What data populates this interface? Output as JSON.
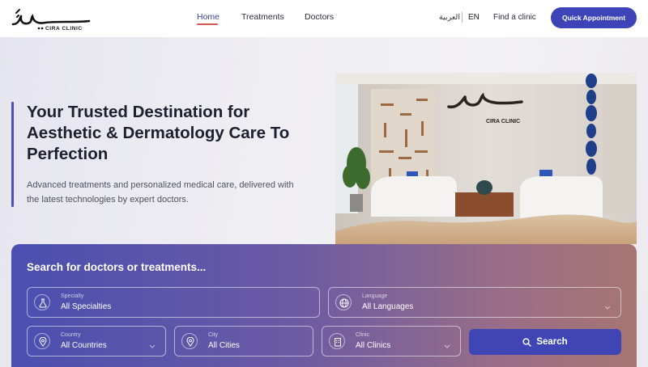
{
  "header": {
    "logo_arabic": "سيرا",
    "logo_text": "CIRA CLINIC",
    "nav": [
      {
        "label": "Home"
      },
      {
        "label": "Treatments"
      },
      {
        "label": "Doctors"
      }
    ],
    "lang_arabic": "العربية",
    "lang_english": "EN",
    "find_clinic": "Find a clinic",
    "cta": "Quick Appointment"
  },
  "hero": {
    "title": "Your Trusted Destination for Aesthetic & Dermatology Care To Perfection",
    "subtitle": "Advanced treatments and personalized medical care, delivered with the latest technologies by expert doctors.",
    "image_sign_arabic": "سيرا",
    "image_sign_text": "CIRA CLINIC"
  },
  "search": {
    "title": "Search for doctors or treatments...",
    "fields": {
      "specialty": {
        "label": "Specialty",
        "value": "All Specialties",
        "icon": "flask-icon"
      },
      "language": {
        "label": "Language",
        "value": "All Languages",
        "icon": "globe-icon"
      },
      "country": {
        "label": "Country",
        "value": "All Countries",
        "icon": "location-pin-icon"
      },
      "city": {
        "label": "City",
        "value": "All Cities",
        "icon": "location-pin-icon"
      },
      "clinic": {
        "label": "Clinic",
        "value": "All Clinics",
        "icon": "building-icon"
      }
    },
    "button": "Search"
  },
  "colors": {
    "accent": "#3d44b8",
    "nav_active_underline": "#d9534f",
    "panel_start": "#4a4fb0",
    "panel_end": "#a67672"
  }
}
